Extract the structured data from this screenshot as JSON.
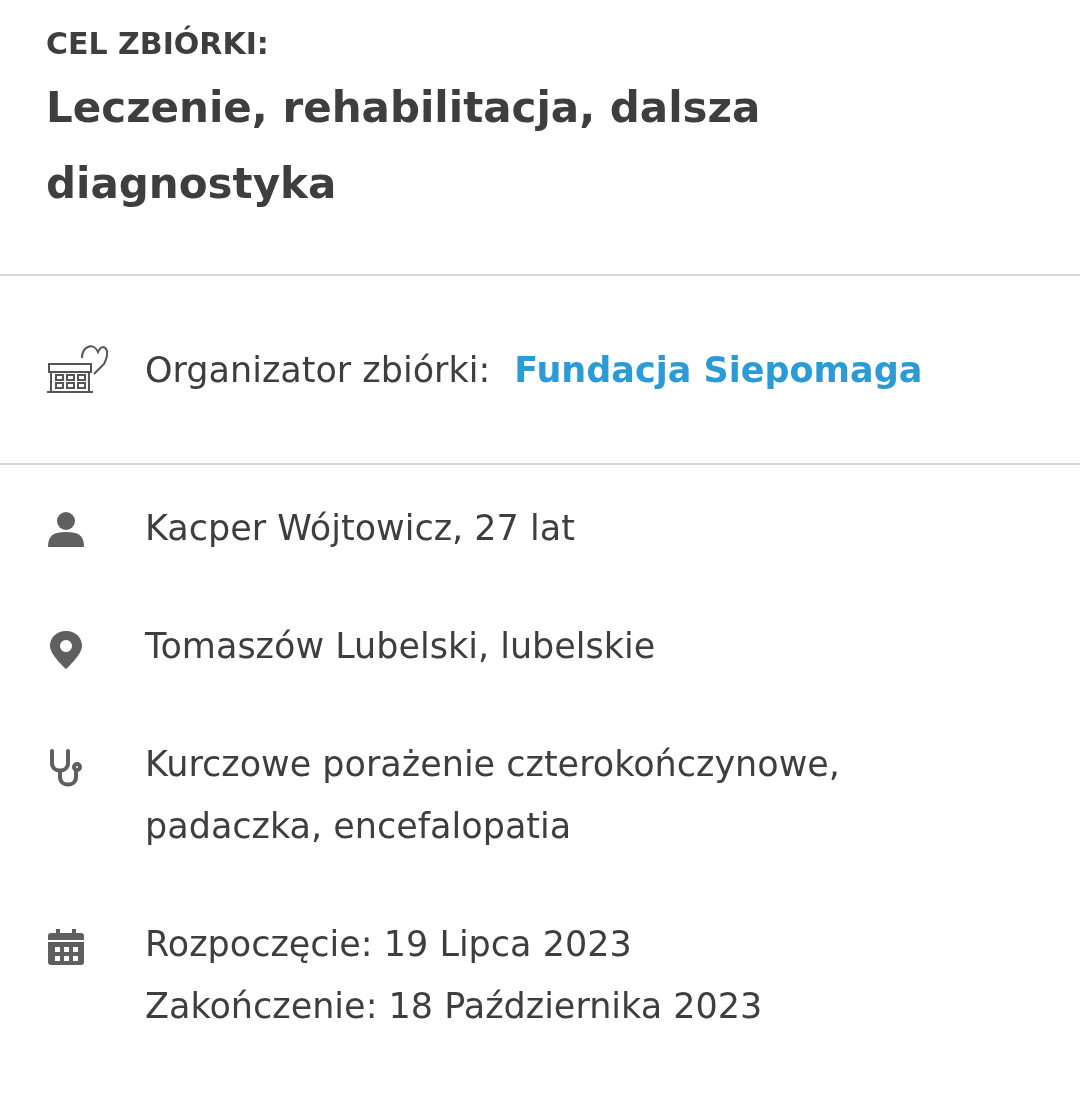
{
  "goal": {
    "label": "CEL ZBIÓRKI:",
    "title": "Leczenie, rehabilitacja, dalsza diagnostyka"
  },
  "organizer": {
    "label": "Organizator zbiórki:",
    "link": "Fundacja Siepomaga"
  },
  "details": [
    {
      "kind": "person",
      "lines": [
        "Kacper Wójtowicz, 27 lat"
      ]
    },
    {
      "kind": "location",
      "lines": [
        "Tomaszów Lubelski, lubelskie"
      ]
    },
    {
      "kind": "diagnosis",
      "lines": [
        "Kurczowe porażenie czterokończynowe,",
        "padaczka, encefalopatia"
      ]
    },
    {
      "kind": "dates",
      "lines": [
        "Rozpoczęcie: 19 Lipca 2023",
        "Zakończenie: 18 Października 2023"
      ]
    }
  ]
}
